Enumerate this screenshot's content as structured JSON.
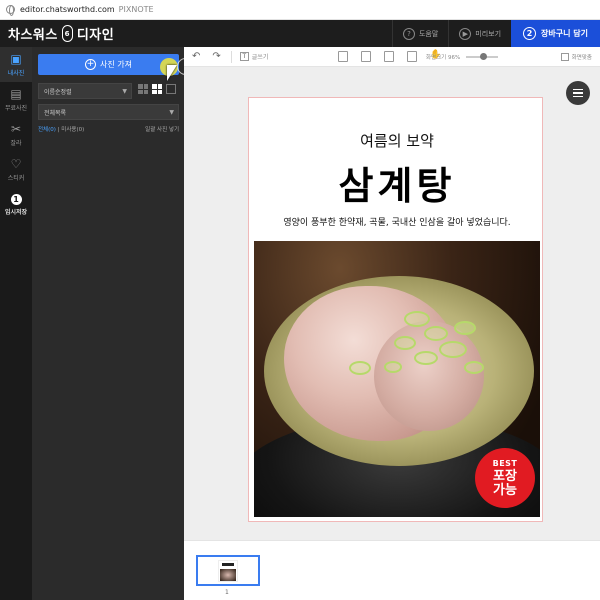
{
  "browser": {
    "url": "editor.chatsworthd.com",
    "suffix": "PIXNOTE"
  },
  "header": {
    "brand_left": "차스워스",
    "brand_num": "6",
    "brand_right": "디자인",
    "help_label": "도움말",
    "preview_label": "미리보기",
    "cart_num": "2",
    "cart_label": "장바구니 담기"
  },
  "rail": {
    "items": [
      {
        "label": "내사진",
        "icon": "photo-icon"
      },
      {
        "label": "무료사진",
        "icon": "free-photo-icon"
      },
      {
        "label": "잘라",
        "icon": "scissors-icon"
      },
      {
        "label": "스티커",
        "icon": "heart-icon"
      },
      {
        "label": "임시저장",
        "num": "1"
      }
    ]
  },
  "panel": {
    "add_label": "사진 가져",
    "sort_value": "이름순정렬",
    "folder_value": "전체목록",
    "filter_all": "전체(0)",
    "filter_unused": "미사용(0)",
    "filter_apply": "일괄 사진 넣기"
  },
  "toolbar": {
    "text_label": "글쓰기",
    "zoom_label": "화면크기 96%",
    "fit_label": "화면맞춤"
  },
  "design": {
    "subtitle": "여름의 보약",
    "title": "삼계탕",
    "description": "영양이 풍부한 한약재, 곡물, 국내산 인삼을 갈아 넣었습니다.",
    "badge_line1": "BEST",
    "badge_line2": "포장",
    "badge_line3": "가능"
  },
  "pages": {
    "thumb_number": "1"
  },
  "colors": {
    "accent_blue": "#3a7cf0",
    "cart_blue": "#1b4fd9",
    "badge_red": "#e11b22"
  }
}
